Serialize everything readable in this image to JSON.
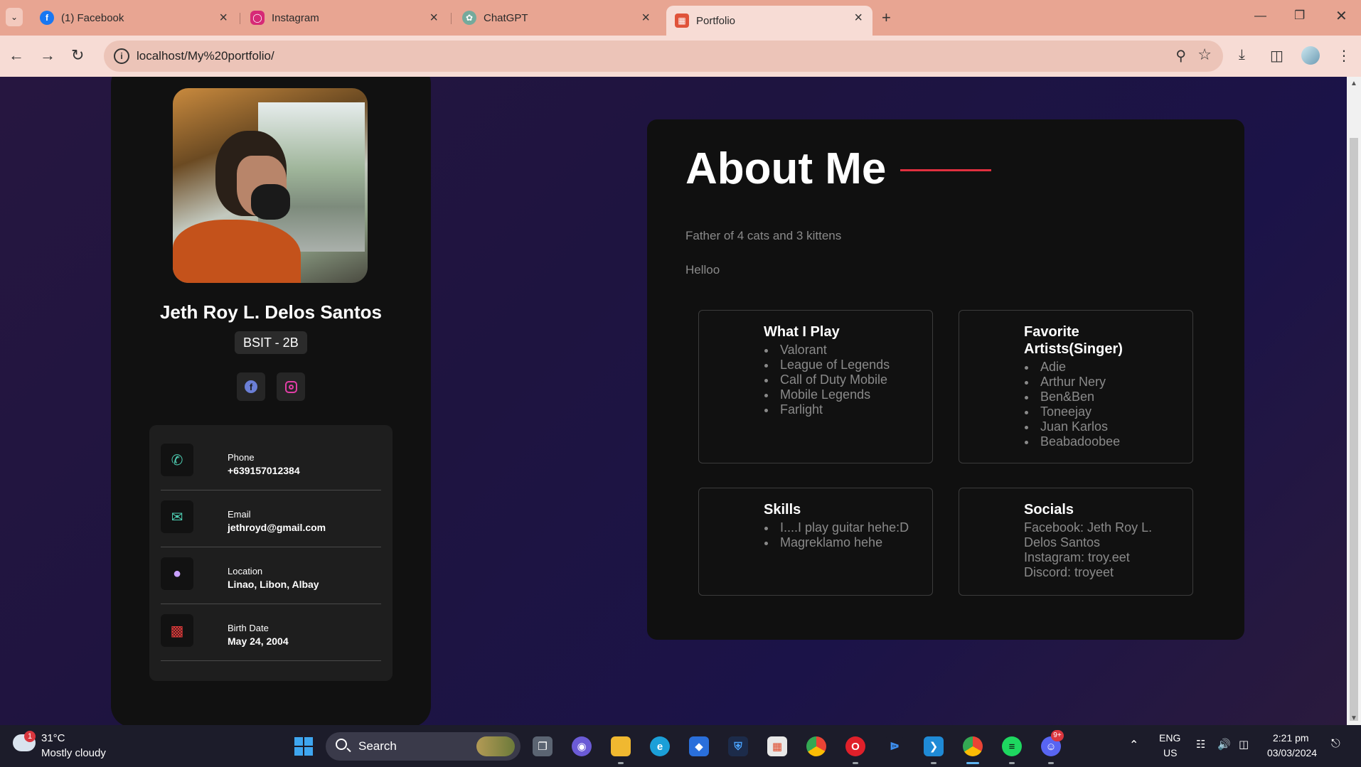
{
  "browser": {
    "tabs": [
      {
        "title": "(1) Facebook",
        "icon": "facebook-icon",
        "color": "#1877f2",
        "active": false
      },
      {
        "title": "Instagram",
        "icon": "instagram-icon",
        "color": "#d62976",
        "active": false
      },
      {
        "title": "ChatGPT",
        "icon": "chatgpt-icon",
        "color": "#74aa9c",
        "active": false
      },
      {
        "title": "Portfolio",
        "icon": "portfolio-icon",
        "color": "#e0533a",
        "active": true
      }
    ],
    "url": "localhost/My%20portfolio/"
  },
  "profile": {
    "name": "Jeth Roy L. Delos Santos",
    "section": "BSIT - 2B",
    "contacts": [
      {
        "label": "Phone",
        "value": "+639157012384",
        "icon": "phone-icon",
        "color": "#4fd1b5"
      },
      {
        "label": "Email",
        "value": "jethroyd@gmail.com",
        "icon": "email-icon",
        "color": "#4fd1b5"
      },
      {
        "label": "Location",
        "value": "Linao, Libon, Albay",
        "icon": "location-icon",
        "color": "#c9a0ff"
      },
      {
        "label": "Birth Date",
        "value": "May 24, 2004",
        "icon": "cake-icon",
        "color": "#e23b3b"
      }
    ]
  },
  "about": {
    "title": "About Me",
    "accent": "#e0303f",
    "p1": "Father of 4 cats and 3 kittens",
    "p2": "Helloo",
    "cards": {
      "play": {
        "title": "What I Play",
        "items": [
          "Valorant",
          "League of Legends",
          "Call of Duty Mobile",
          "Mobile Legends",
          "Farlight"
        ]
      },
      "artists": {
        "title": "Favorite Artists(Singer)",
        "items": [
          "Adie",
          "Arthur Nery",
          "Ben&Ben",
          "Toneejay",
          "Juan Karlos",
          "Beabadoobee"
        ]
      },
      "skills": {
        "title": "Skills",
        "items": [
          "I....I play guitar hehe:D",
          "Magreklamo hehe"
        ]
      },
      "socials": {
        "title": "Socials",
        "lines": [
          "Facebook: Jeth Roy L.",
          "Delos Santos",
          "Instagram: troy.eet",
          "Discord: troyeet"
        ]
      }
    }
  },
  "taskbar": {
    "weather_temp": "31°C",
    "weather_desc": "Mostly cloudy",
    "weather_badge": "1",
    "search_label": "Search",
    "lang_top": "ENG",
    "lang_bottom": "US",
    "time": "2:21 pm",
    "date": "03/03/2024",
    "discord_badge": "9+"
  }
}
